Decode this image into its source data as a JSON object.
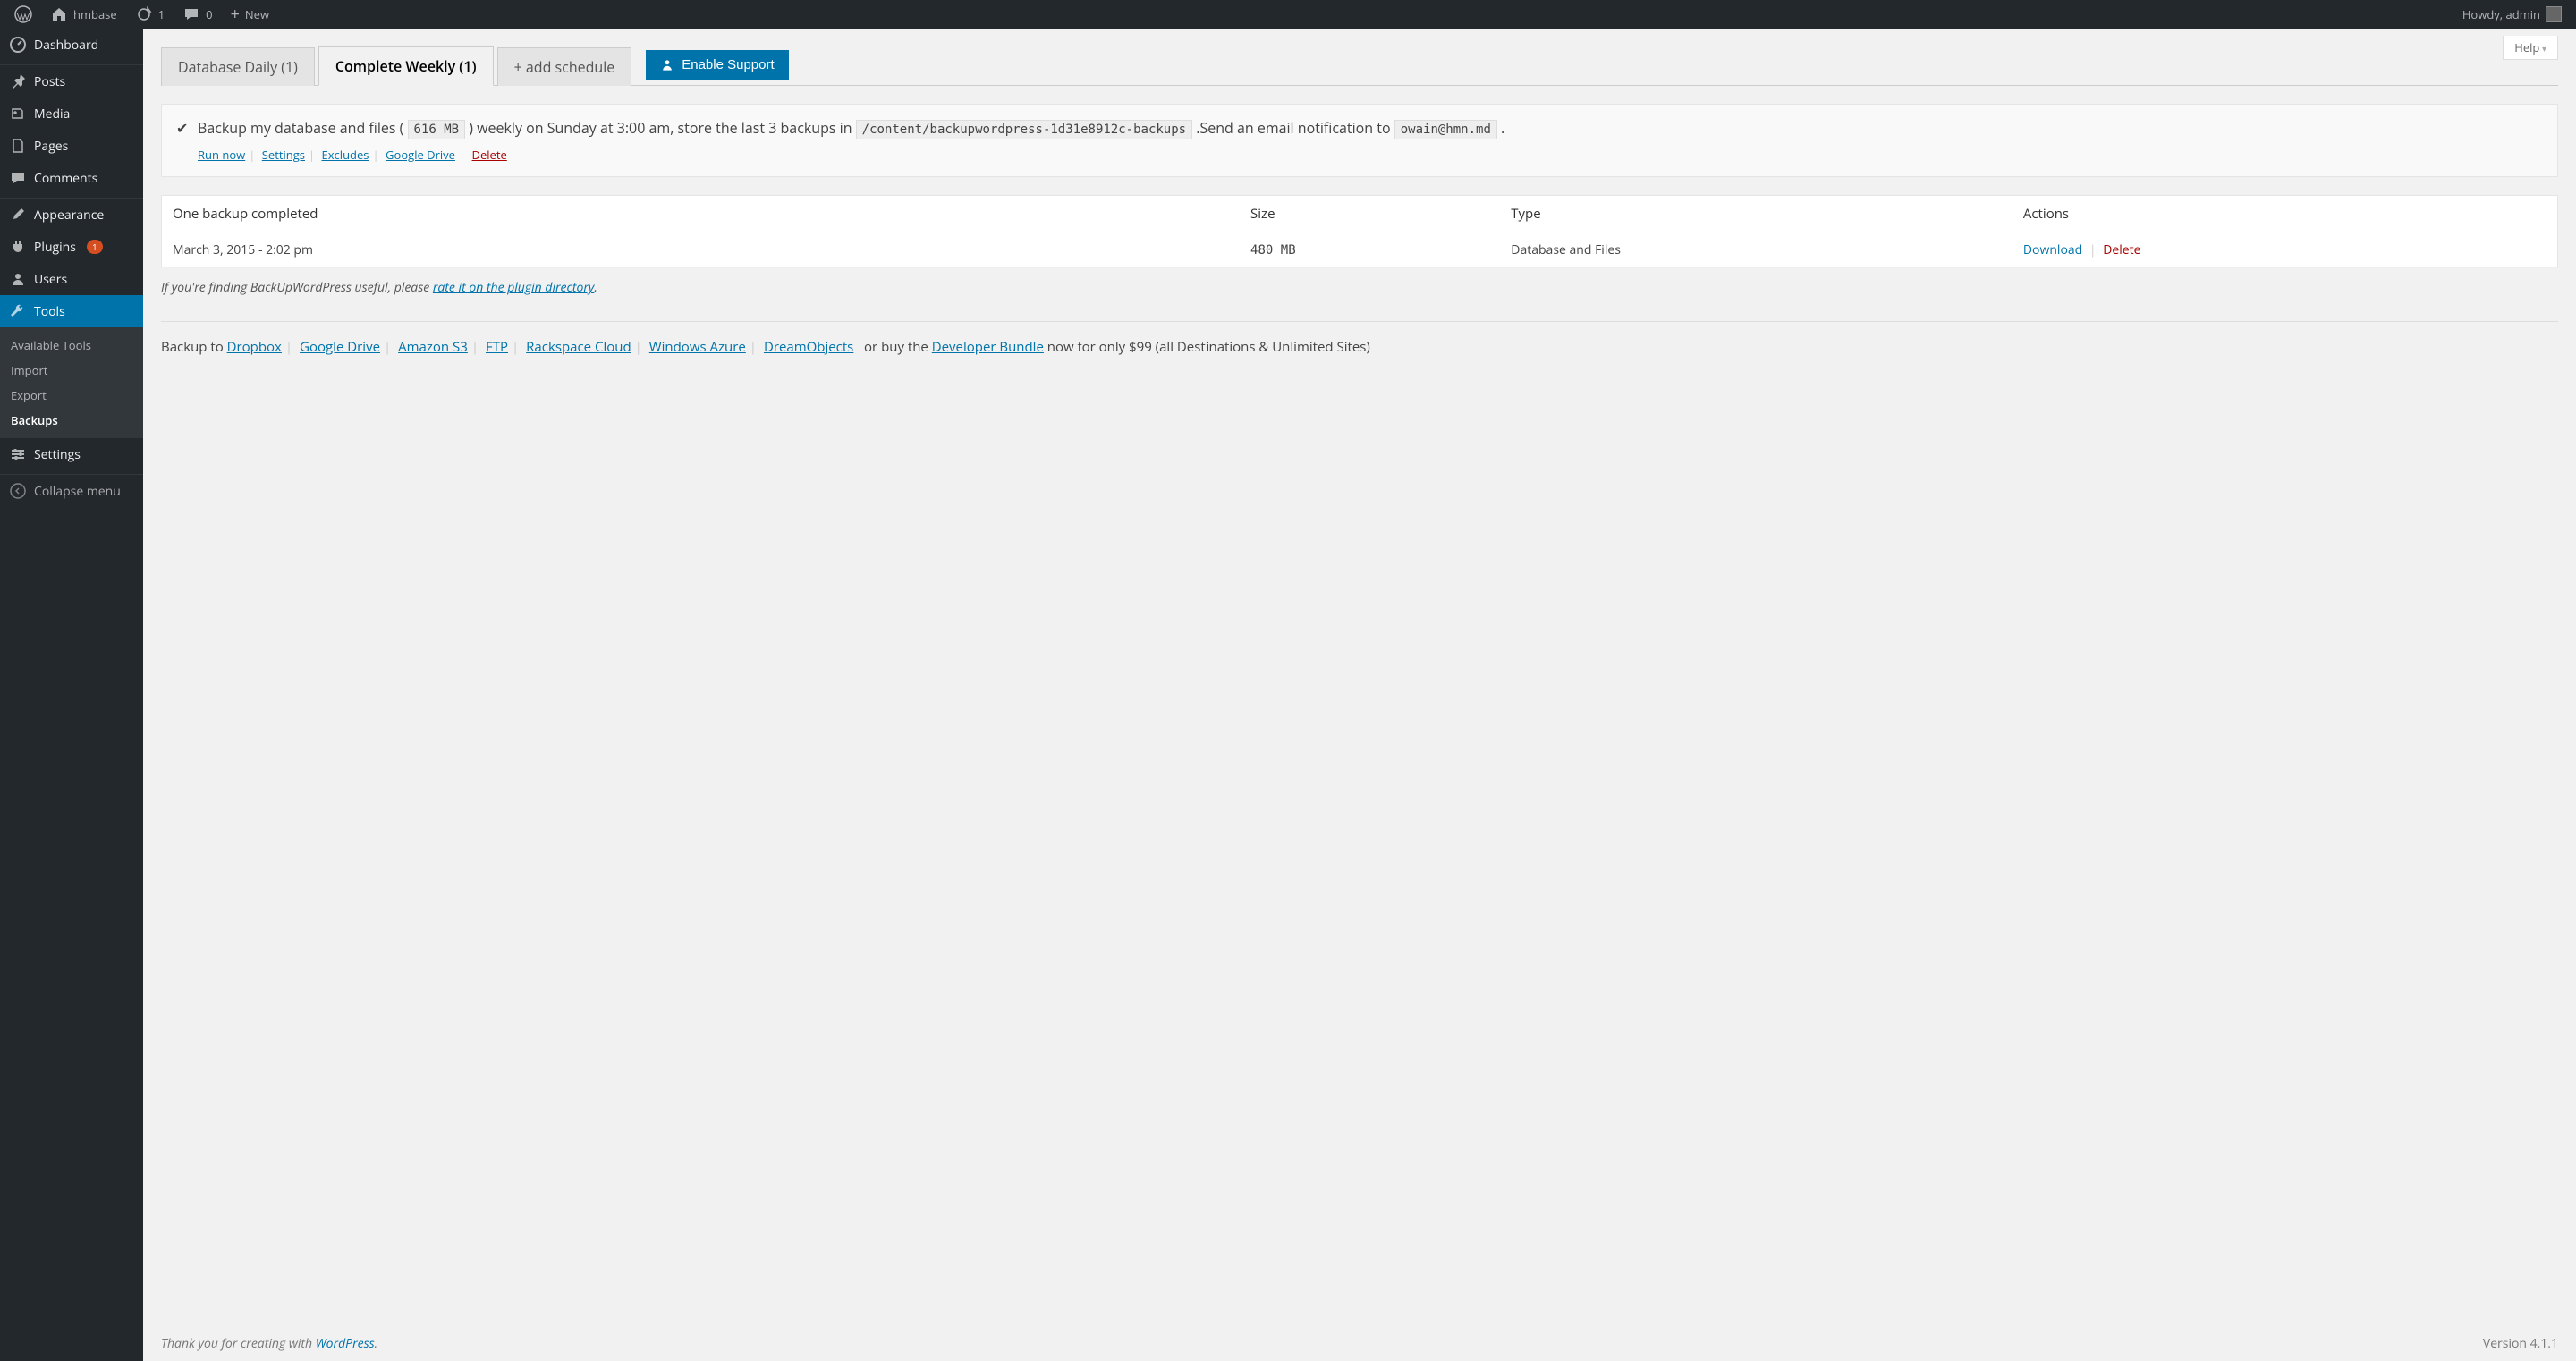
{
  "adminbar": {
    "site": "hmbase",
    "updates": "1",
    "comments": "0",
    "new": "New",
    "howdy": "Howdy, admin"
  },
  "sidebar": {
    "items": [
      {
        "label": "Dashboard"
      },
      {
        "label": "Posts"
      },
      {
        "label": "Media"
      },
      {
        "label": "Pages"
      },
      {
        "label": "Comments"
      },
      {
        "label": "Appearance"
      },
      {
        "label": "Plugins",
        "badge": "1"
      },
      {
        "label": "Users"
      },
      {
        "label": "Tools"
      },
      {
        "label": "Settings"
      }
    ],
    "submenu": [
      {
        "label": "Available Tools"
      },
      {
        "label": "Import"
      },
      {
        "label": "Export"
      },
      {
        "label": "Backups"
      }
    ],
    "collapse": "Collapse menu"
  },
  "help": "Help",
  "tabs": {
    "daily": "Database Daily (1)",
    "weekly": "Complete Weekly (1)",
    "add": "+ add schedule",
    "enable": "Enable Support"
  },
  "summary": {
    "text1": "Backup my database and files (",
    "size": "616 MB",
    "text2": ") weekly on Sunday at 3:00 am, store the last 3 backups in",
    "path": "/content/backupwordpress-1d31e8912c-backups",
    "text3": ".Send an email notification to",
    "email": "owain@hmn.md",
    "actions": {
      "run": "Run now",
      "settings": "Settings",
      "excludes": "Excludes",
      "gdrive": "Google Drive",
      "delete": "Delete"
    }
  },
  "table": {
    "headers": {
      "status": "One backup completed",
      "size": "Size",
      "type": "Type",
      "actions": "Actions"
    },
    "rows": [
      {
        "date": "March 3, 2015 - 2:02 pm",
        "size": "480 MB",
        "type": "Database and Files",
        "download": "Download",
        "delete": "Delete"
      }
    ]
  },
  "rate": {
    "pre": "If you're finding BackUpWordPress useful, please ",
    "link": "rate it on the plugin directory",
    "post": "."
  },
  "dest": {
    "prefix": "Backup to ",
    "links": [
      "Dropbox",
      "Google Drive",
      "Amazon S3",
      "FTP",
      "Rackspace Cloud",
      "Windows Azure",
      "DreamObjects"
    ],
    "or": " or buy the ",
    "bundle": "Developer Bundle",
    "suffix": " now for only $99 (all Destinations & Unlimited Sites)"
  },
  "footer": {
    "thank": "Thank you for creating with ",
    "wp": "WordPress",
    "version": "Version 4.1.1"
  }
}
